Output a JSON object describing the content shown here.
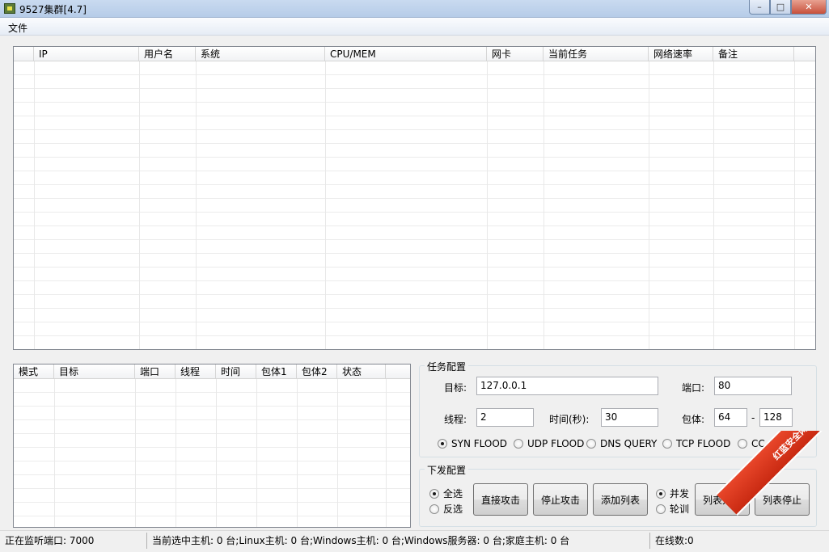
{
  "window": {
    "title": "9527集群[4.7]",
    "buttons": {
      "minimize": "–",
      "maximize": "□",
      "close": "✕"
    }
  },
  "menu": {
    "file": "文件"
  },
  "hosts_table": {
    "columns": [
      "IP",
      "用户名",
      "系统",
      "CPU/MEM",
      "网卡",
      "当前任务",
      "网络速率",
      "备注"
    ],
    "rows": []
  },
  "tasks_table": {
    "columns": [
      "模式",
      "目标",
      "端口",
      "线程",
      "时间",
      "包体1",
      "包体2",
      "状态"
    ],
    "rows": []
  },
  "task_config": {
    "title": "任务配置",
    "target_label": "目标:",
    "target_value": "127.0.0.1",
    "port_label": "端口:",
    "port_value": "80",
    "threads_label": "线程:",
    "threads_value": "2",
    "time_label": "时间(秒):",
    "time_value": "30",
    "packet_label": "包体:",
    "packet_min": "64",
    "packet_sep": "-",
    "packet_max": "128",
    "modes": [
      {
        "label": "SYN FLOOD",
        "checked": true
      },
      {
        "label": "UDP FLOOD",
        "checked": false
      },
      {
        "label": "DNS QUERY",
        "checked": false
      },
      {
        "label": "TCP FLOOD",
        "checked": false
      },
      {
        "label": "CC ATTACK",
        "checked": false
      }
    ]
  },
  "dispatch_config": {
    "title": "下发配置",
    "select_all": "全选",
    "invert_select": "反选",
    "direct_attack": "直接攻击",
    "stop_attack": "停止攻击",
    "add_list": "添加列表",
    "concurrent": "并发",
    "round_robin": "轮训",
    "list_start": "列表开始",
    "list_stop": "列表停止"
  },
  "status": {
    "listening": "正在监听端口: 7000",
    "hosts_summary": "当前选中主机: 0 台;Linux主机: 0 台;Windows主机: 0 台;Windows服务器: 0 台;家庭主机: 0 台",
    "online": "在线数:0"
  },
  "watermark": {
    "text": "红蓝安全网"
  }
}
